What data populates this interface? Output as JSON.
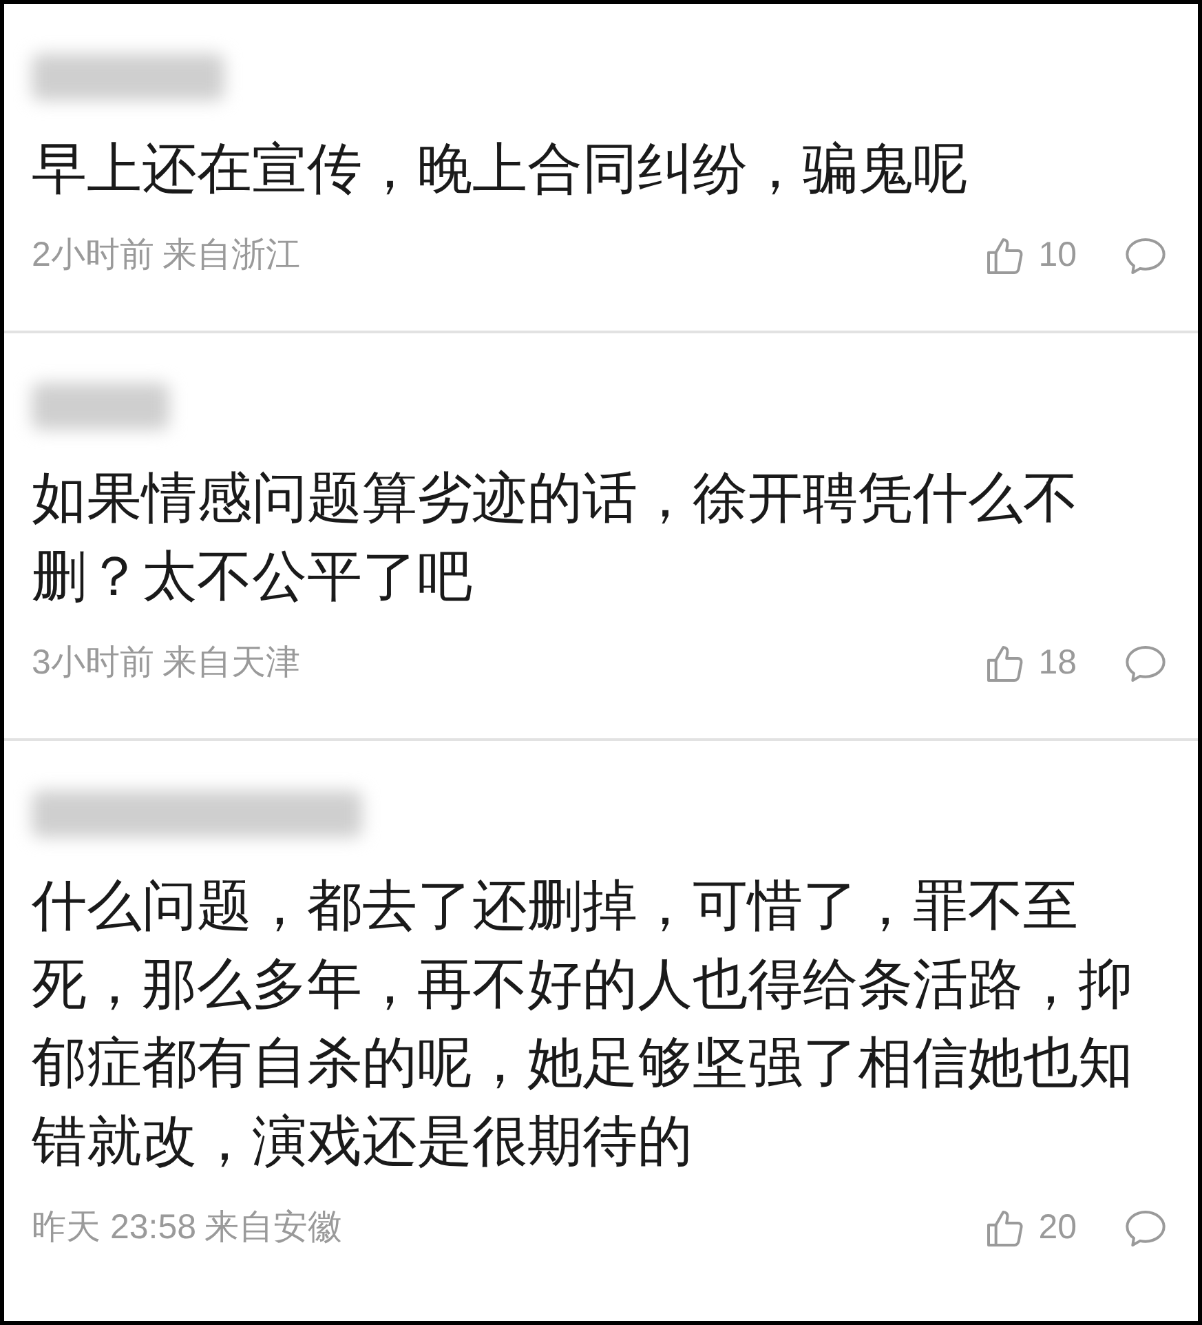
{
  "comments": [
    {
      "text": "早上还在宣传，晚上合同纠纷，骗鬼呢",
      "time": "2小时前",
      "location": "来自浙江",
      "likes": "10"
    },
    {
      "text": "如果情感问题算劣迹的话，徐开聘凭什么不删？太不公平了吧",
      "time": "3小时前",
      "location": "来自天津",
      "likes": "18"
    },
    {
      "text": "什么问题，都去了还删掉，可惜了，罪不至死，那么多年，再不好的人也得给条活路，抑郁症都有自杀的呢，她足够坚强了相信她也知错就改，演戏还是很期待的",
      "time": "昨天 23:58",
      "location": "来自安徽",
      "likes": "20"
    }
  ]
}
